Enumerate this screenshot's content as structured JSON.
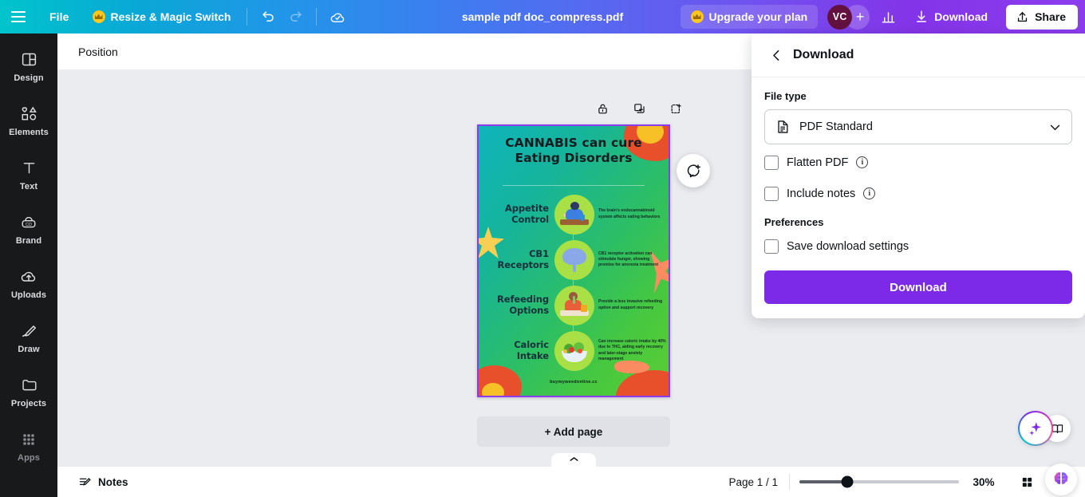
{
  "topbar": {
    "menu_icon": "hamburger-icon",
    "file_label": "File",
    "resize_label": "Resize & Magic Switch",
    "undo_icon": "undo-icon",
    "redo_icon": "redo-icon",
    "cloud_sync_icon": "cloud-check-icon",
    "doc_title": "sample pdf doc_compress.pdf",
    "upgrade_label": "Upgrade your plan",
    "avatar_initials": "VC",
    "add_collaborator_label": "+",
    "insights_icon": "bar-chart-icon",
    "download_label": "Download",
    "share_label": "Share"
  },
  "sidebar": {
    "items": [
      {
        "label": "Design",
        "icon": "design-layout-icon"
      },
      {
        "label": "Elements",
        "icon": "shapes-icon"
      },
      {
        "label": "Text",
        "icon": "text-t-icon"
      },
      {
        "label": "Brand",
        "icon": "brand-badge-icon"
      },
      {
        "label": "Uploads",
        "icon": "upload-cloud-icon"
      },
      {
        "label": "Draw",
        "icon": "pencil-draw-icon"
      },
      {
        "label": "Projects",
        "icon": "folder-icon"
      },
      {
        "label": "Apps",
        "icon": "grid-apps-icon"
      }
    ]
  },
  "toolbar": {
    "position_label": "Position"
  },
  "canvas": {
    "page_tools": [
      {
        "name": "lock-page-button",
        "icon": "lock-icon"
      },
      {
        "name": "duplicate-page-button",
        "icon": "duplicate-icon"
      },
      {
        "name": "add-page-button",
        "icon": "add-page-icon"
      }
    ],
    "comment_fab_icon": "add-comment-icon",
    "add_page_label": "+ Add page",
    "collapse_icon": "chevron-up-icon",
    "poster": {
      "title_line1": "CANNABIS can cure",
      "title_line2": "Eating Disorders",
      "rows": [
        {
          "label_line1": "Appetite",
          "label_line2": "Control",
          "text": "The brain's endocannabinoid system affects eating behaviors",
          "illustration": "person-eating-at-table-icon"
        },
        {
          "label_line1": "CB1",
          "label_line2": "Receptors",
          "text": "CB1 receptor activation can stimulate hunger, showing promise for anorexia treatment",
          "illustration": "brain-icon"
        },
        {
          "label_line1": "Refeeding",
          "label_line2": "Options",
          "text": "Provide a less invasive refeeding option and support recovery",
          "illustration": "person-with-feeding-tube-icon"
        },
        {
          "label_line1": "Caloric",
          "label_line2": "Intake",
          "text": "Can increase caloric intake by 40% due to THC, aiding early recovery and later-stage anxiety management",
          "illustration": "salad-bowl-icon"
        }
      ],
      "footer": "buymyweedonline.cc"
    }
  },
  "bottombar": {
    "notes_label": "Notes",
    "notes_icon": "notes-pencil-icon",
    "page_indicator": "Page 1 / 1",
    "zoom_level": "30%",
    "zoom_percent": 30,
    "grid_view_icon": "grid-view-icon",
    "fullscreen_icon": "expand-arrows-icon"
  },
  "assistants": {
    "magic_icon": "magic-sparkle-icon",
    "book_icon": "open-book-icon",
    "brain_icon": "ai-brain-icon"
  },
  "download_panel": {
    "back_icon": "chevron-left-icon",
    "title": "Download",
    "file_type_label": "File type",
    "file_type_value": "PDF Standard",
    "file_type_icon": "pdf-document-icon",
    "chevron_icon": "chevron-down-icon",
    "options": [
      {
        "label": "Flatten PDF",
        "checked": false,
        "has_info": true
      },
      {
        "label": "Include notes",
        "checked": false,
        "has_info": true
      }
    ],
    "preferences_label": "Preferences",
    "preference_options": [
      {
        "label": "Save download settings",
        "checked": false,
        "has_info": false
      }
    ],
    "download_button_label": "Download"
  },
  "colors": {
    "accent_purple": "#7d2ae8",
    "brand_teal": "#00c4cc",
    "avatar_bg": "#63123f",
    "sidebar_bg": "#18191b",
    "canvas_bg": "#ebecf0"
  }
}
